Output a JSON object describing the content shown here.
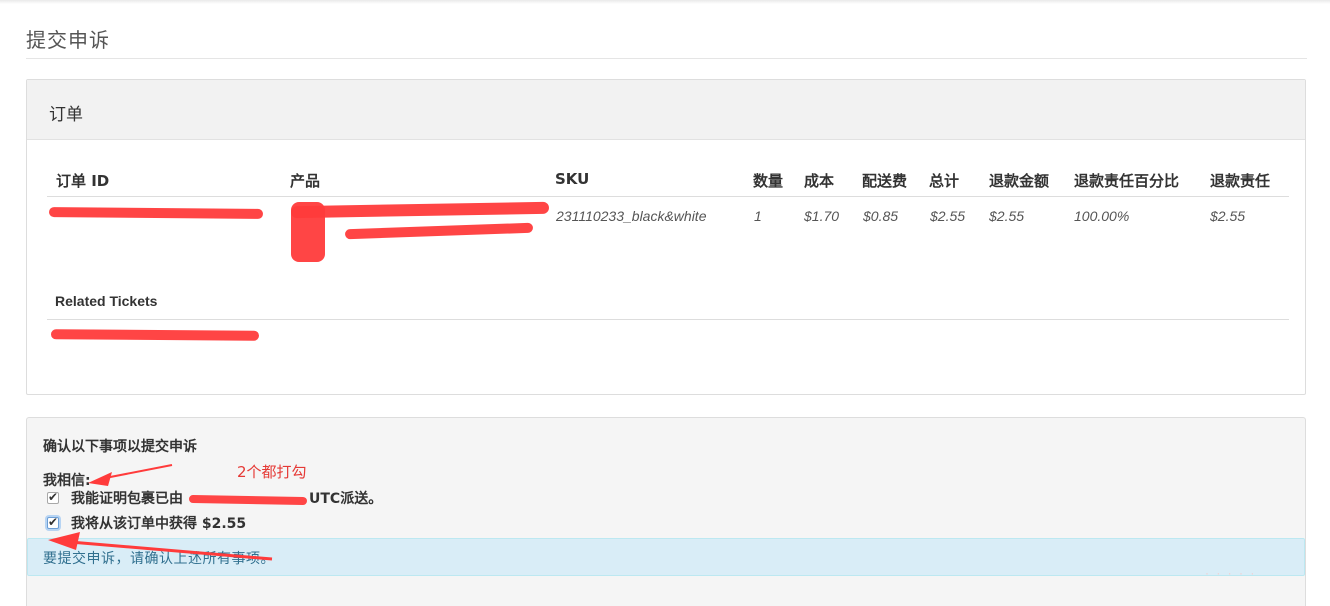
{
  "page": {
    "title": "提交申诉"
  },
  "order_panel": {
    "title": "订单",
    "columns": {
      "order_id": "订单 ID",
      "product": "产品",
      "sku": "SKU",
      "quantity": "数量",
      "cost": "成本",
      "shipping": "配送费",
      "total": "总计",
      "refund_amount": "退款金额",
      "refund_liability_pct": "退款责任百分比",
      "refund_liability": "退款责任"
    },
    "row": {
      "sku": "231110233_black&white",
      "quantity": "1",
      "cost": "$1.70",
      "shipping": "$0.85",
      "total": "$2.55",
      "refund_amount": "$2.55",
      "refund_liability_pct": "100.00%",
      "refund_liability": "$2.55"
    },
    "related_tickets": {
      "title": "Related Tickets"
    }
  },
  "confirm_panel": {
    "title": "确认以下事项以提交申诉",
    "believe_label": "我相信:",
    "checks": [
      {
        "label_prefix": "我能证明包裹已由",
        "label_suffix": "UTC派送。",
        "checked": true
      },
      {
        "label": "我将从该订单中获得 $2.55",
        "checked": true
      }
    ],
    "alert": "要提交申诉，请确认上述所有事项。"
  },
  "annotation": {
    "text": "2个都打勾",
    "color": "#e53935"
  },
  "colors": {
    "alert_bg": "#d9edf7",
    "alert_text": "#31708f",
    "redaction": "#ff3b3b"
  }
}
